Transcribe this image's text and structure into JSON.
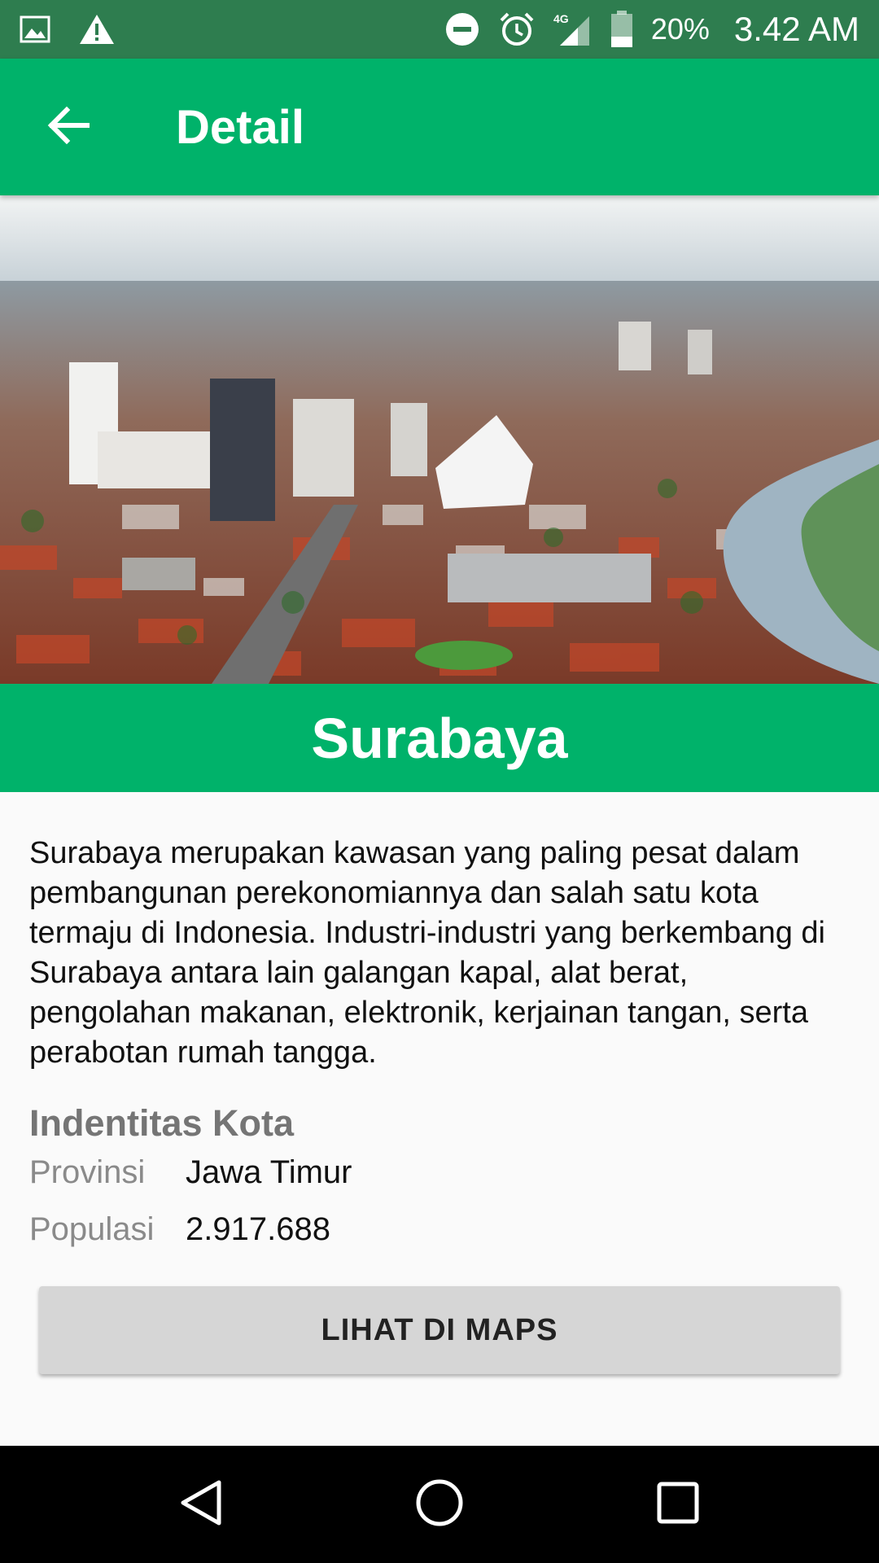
{
  "status_bar": {
    "network": "4G",
    "battery_percent": "20%",
    "time": "3.42 AM",
    "icons": [
      "image-icon",
      "warning-icon",
      "do-not-disturb-icon",
      "alarm-icon",
      "signal-icon",
      "battery-icon"
    ]
  },
  "app_bar": {
    "title": "Detail",
    "back_icon": "arrow-left-icon"
  },
  "city": {
    "name": "Surabaya",
    "description": "Surabaya merupakan kawasan yang paling pesat dalam pembangunan perekonomiannya dan salah satu kota termaju di Indonesia. Industri-industri yang berkembang di Surabaya antara lain galangan kapal, alat berat, pengolahan makanan, elektronik, kerjainan tangan, serta perabotan rumah tangga.",
    "identity_title": "Indentitas Kota",
    "province_label": "Provinsi",
    "province_value": "Jawa Timur",
    "population_label": "Populasi",
    "population_value": "2.917.688"
  },
  "button": {
    "maps_label": "LIHAT DI MAPS"
  },
  "nav_bar": {
    "icons": [
      "back-triangle-icon",
      "home-circle-icon",
      "recents-square-icon"
    ]
  },
  "colors": {
    "primary": "#00b26a",
    "status_bar": "#2e7d4f",
    "button": "#d6d6d6"
  }
}
